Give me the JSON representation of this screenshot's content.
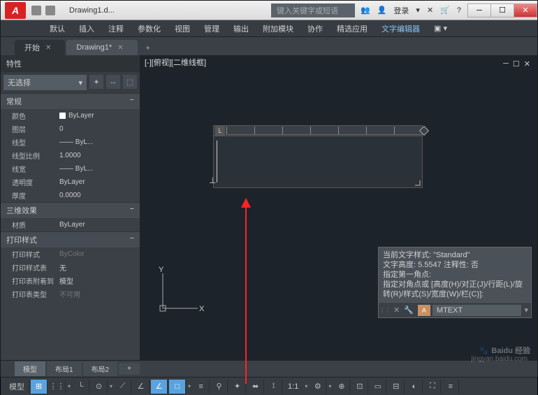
{
  "title": "Drawing1.d...",
  "search_placeholder": "键入关键字或短语",
  "login_text": "登录",
  "ribbon": [
    "默认",
    "插入",
    "注释",
    "参数化",
    "视图",
    "管理",
    "输出",
    "附加模块",
    "协作",
    "精选应用",
    "文字编辑器"
  ],
  "ribbon_active": 10,
  "file_tabs": [
    {
      "label": "开始",
      "active": false
    },
    {
      "label": "Drawing1*",
      "active": true
    }
  ],
  "props": {
    "title": "特性",
    "selection": "无选择",
    "sections": [
      {
        "name": "常规",
        "rows": [
          {
            "label": "颜色",
            "value": "ByLayer",
            "swatch": true
          },
          {
            "label": "图层",
            "value": "0"
          },
          {
            "label": "线型",
            "value": "—— ByL..."
          },
          {
            "label": "线型比例",
            "value": "1.0000"
          },
          {
            "label": "线宽",
            "value": "—— ByL..."
          },
          {
            "label": "透明度",
            "value": "ByLayer"
          },
          {
            "label": "厚度",
            "value": "0.0000"
          }
        ]
      },
      {
        "name": "三维效果",
        "rows": [
          {
            "label": "材质",
            "value": "ByLayer"
          }
        ]
      },
      {
        "name": "打印样式",
        "rows": [
          {
            "label": "打印样式",
            "value": "ByColor",
            "dim": true
          },
          {
            "label": "打印样式表",
            "value": "无"
          },
          {
            "label": "打印表附着到",
            "value": "模型"
          },
          {
            "label": "打印表类型",
            "value": "不可用",
            "dim": true
          }
        ]
      }
    ]
  },
  "view_label": "[-][俯视][二维线框]",
  "cmd": {
    "lines": [
      "当前文字样式: \"Standard\"",
      "文字高度: 5.5547  注释性: 否",
      "指定第一角点:",
      "指定对角点或 [高度(H)/对正(J)/行距(L)/旋转(R)/样式(S)/宽度(W)/栏(C)]:"
    ],
    "prompt": "MTEXT"
  },
  "layout_tabs": [
    "模型",
    "布局1",
    "布局2"
  ],
  "status_model": "模型",
  "status_scale": "1:1",
  "ucs": {
    "x": "X",
    "y": "Y"
  },
  "watermark": "Baidu 经验",
  "watermark_sub": "jingyan.baidu.com"
}
